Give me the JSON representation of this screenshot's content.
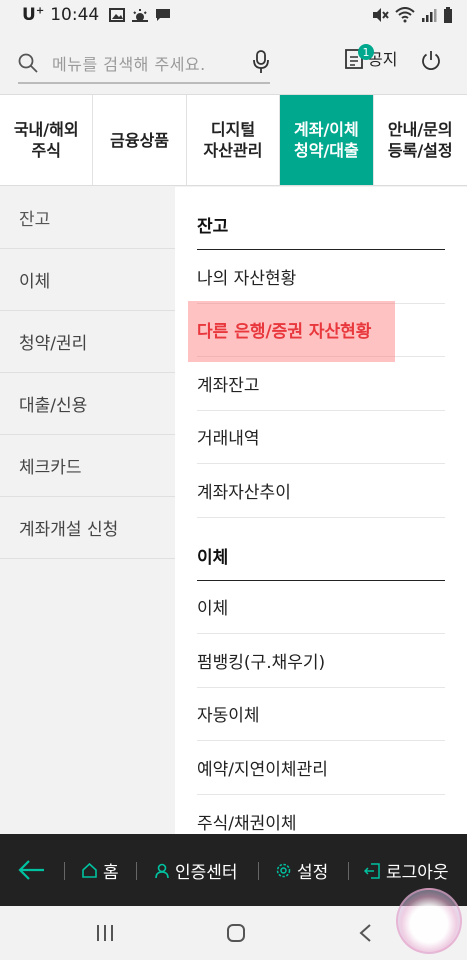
{
  "status_bar": {
    "carrier": "U",
    "carrier_sup": "+",
    "time": "10:44"
  },
  "header": {
    "search_placeholder": "메뉴를 검색해 주세요.",
    "notice_label": "공지",
    "notice_count": "1"
  },
  "tabs": [
    {
      "label": "국내/해외\n주식"
    },
    {
      "label": "금융상품"
    },
    {
      "label": "디지털\n자산관리"
    },
    {
      "label": "계좌/이체\n청약/대출"
    },
    {
      "label": "안내/문의\n등록/설정"
    }
  ],
  "side_menu": [
    {
      "label": "잔고"
    },
    {
      "label": "이체"
    },
    {
      "label": "청약/권리"
    },
    {
      "label": "대출/신용"
    },
    {
      "label": "체크카드"
    },
    {
      "label": "계좌개설 신청"
    }
  ],
  "content": {
    "section1_title": "잔고",
    "section1_items": [
      "나의 자산현황",
      "다른 은행/증권 자산현황",
      "계좌잔고",
      "거래내역",
      "계좌자산추이"
    ],
    "section2_title": "이체",
    "section2_items": [
      "이체",
      "펌뱅킹(구.채우기)",
      "자동이체",
      "예약/지연이체관리",
      "주식/채권이체"
    ]
  },
  "bottom_nav": {
    "home": "홈",
    "cert": "인증센터",
    "settings": "설정",
    "logout": "로그아웃"
  },
  "colors": {
    "accent": "#00a88e",
    "highlight_text": "#e8383d",
    "bottom_bar": "#222222"
  }
}
